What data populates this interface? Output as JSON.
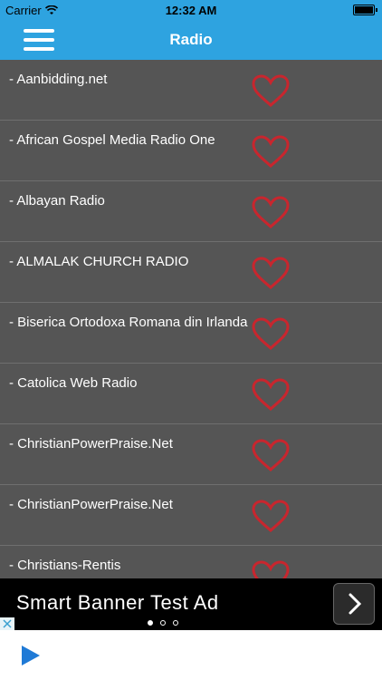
{
  "status_bar": {
    "carrier": "Carrier",
    "time": "12:32 AM"
  },
  "nav": {
    "title": "Radio",
    "menu_icon": "hamburger-menu-icon"
  },
  "colors": {
    "accent": "#2ea3e0",
    "row_bg": "#555555",
    "heart": "#c8262e"
  },
  "stations": [
    {
      "name": "- Aanbidding.net"
    },
    {
      "name": "- African Gospel Media Radio  One"
    },
    {
      "name": "- Albayan Radio"
    },
    {
      "name": "- ALMALAK CHURCH RADIO"
    },
    {
      "name": "- Biserica Ortodoxa Romana din Irlanda"
    },
    {
      "name": "- Catolica Web Radio"
    },
    {
      "name": "- ChristianPowerPraise.Net"
    },
    {
      "name": "- ChristianPowerPraise.Net"
    },
    {
      "name": "- Christians-Rentis"
    }
  ],
  "ad": {
    "text": "Smart Banner Test Ad",
    "page_count": 3,
    "active_page": 1
  }
}
